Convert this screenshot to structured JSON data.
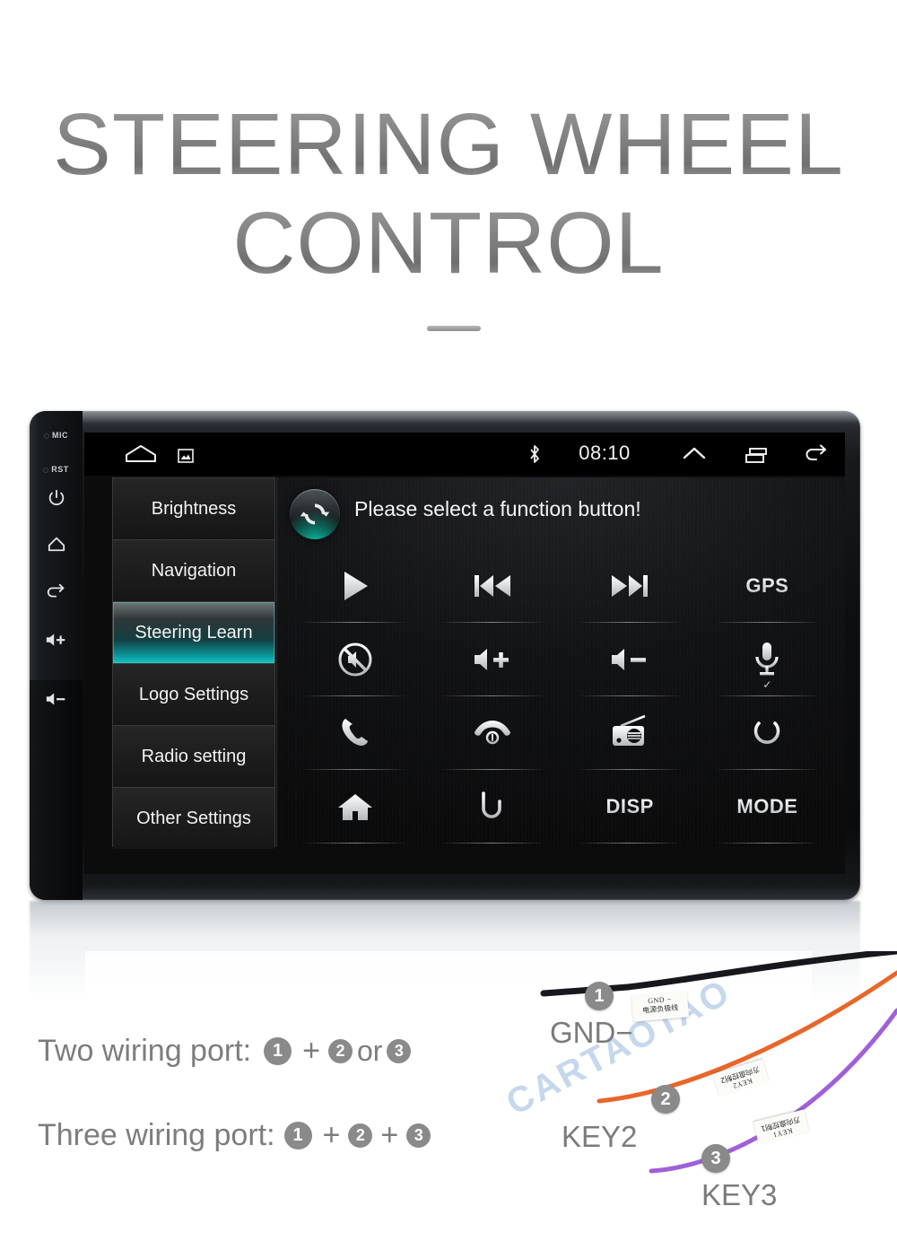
{
  "hero": {
    "line1": "STEERING WHEEL",
    "line2": "CONTROL"
  },
  "device": {
    "bezel": {
      "mic_label": "MIC",
      "rst_label": "RST",
      "icons": [
        "power-icon",
        "home-icon",
        "back-icon",
        "volume-up-icon",
        "volume-down-icon"
      ]
    },
    "statusbar": {
      "home_icon": "home-icon",
      "screenshot_icon": "screenshot-icon",
      "bluetooth_icon": "bluetooth-icon",
      "time": "08:10",
      "expand_icon": "chevron-up-icon",
      "recents_icon": "recents-icon",
      "back_icon": "back-icon"
    },
    "menu": {
      "items": [
        {
          "label": "Brightness",
          "active": false
        },
        {
          "label": "Navigation",
          "active": false
        },
        {
          "label": "Steering Learn",
          "active": true
        },
        {
          "label": "Logo Settings",
          "active": false
        },
        {
          "label": "Radio setting",
          "active": false
        },
        {
          "label": "Other Settings",
          "active": false
        }
      ]
    },
    "panel": {
      "refresh_icon": "refresh-icon",
      "title": "Please select a function button!",
      "buttons": [
        {
          "name": "play-icon",
          "kind": "icon",
          "label": ""
        },
        {
          "name": "previous-track-icon",
          "kind": "icon",
          "label": ""
        },
        {
          "name": "next-track-icon",
          "kind": "icon",
          "label": ""
        },
        {
          "name": "gps-button",
          "kind": "text",
          "label": "GPS"
        },
        {
          "name": "mute-icon",
          "kind": "icon",
          "label": ""
        },
        {
          "name": "volume-up-icon",
          "kind": "icon",
          "label": ""
        },
        {
          "name": "volume-down-icon",
          "kind": "icon",
          "label": ""
        },
        {
          "name": "microphone-icon",
          "kind": "icon",
          "label": "",
          "check": "✓"
        },
        {
          "name": "call-answer-icon",
          "kind": "icon",
          "label": ""
        },
        {
          "name": "call-end-icon",
          "kind": "icon",
          "label": ""
        },
        {
          "name": "radio-icon",
          "kind": "icon",
          "label": ""
        },
        {
          "name": "power-icon",
          "kind": "icon",
          "label": ""
        },
        {
          "name": "home-icon",
          "kind": "icon",
          "label": ""
        },
        {
          "name": "back-icon",
          "kind": "icon",
          "label": ""
        },
        {
          "name": "disp-button",
          "kind": "text",
          "label": "DISP"
        },
        {
          "name": "mode-button",
          "kind": "text",
          "label": "MODE"
        }
      ]
    }
  },
  "legend": {
    "two_label": "Two wiring port:",
    "two_n1": "1",
    "two_plus": "+",
    "two_n2": "2",
    "two_or": "or",
    "two_n3": "3",
    "three_label": "Three wiring port:",
    "three_n1": "1",
    "three_plus1": "+",
    "three_n2": "2",
    "three_plus2": "+",
    "three_n3": "3"
  },
  "wiring": {
    "watermark": "CARTAOTAO",
    "badge1": "1",
    "badge2": "2",
    "badge3": "3",
    "caption_gnd": "GND−",
    "caption_key2": "KEY2",
    "caption_key3": "KEY3",
    "label_gnd_en": "GND −",
    "label_gnd_cn": "电源负极线",
    "label_key2_en": "KEY2",
    "label_key2_cn": "方向盘控制2",
    "label_key1_en": "KEY1",
    "label_key1_cn": "方向盘控制1"
  },
  "colors": {
    "accent_teal": "#14c4c4",
    "text_gray": "#7d7d7d",
    "badge_gray": "#8a8a8a",
    "wire_black": "#15151a",
    "wire_orange": "#e8662a",
    "wire_purple": "#a060d8",
    "watermark_blue": "#bcd2ea"
  }
}
